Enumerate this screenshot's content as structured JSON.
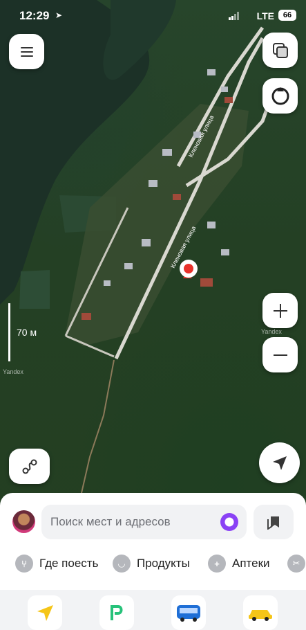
{
  "status_bar": {
    "time": "12:29",
    "network": "LTE",
    "battery": "66"
  },
  "map": {
    "scale_label": "70 м",
    "watermark": "Yandex",
    "street_label": "Кленовая улица"
  },
  "search": {
    "placeholder": "Поиск мест и адресов"
  },
  "categories": [
    {
      "label": "Где поесть",
      "icon": "fork-knife-icon"
    },
    {
      "label": "Продукты",
      "icon": "basket-icon"
    },
    {
      "label": "Аптеки",
      "icon": "pharmacy-cross-icon"
    }
  ],
  "colors": {
    "accent_purple": "#8a42f5",
    "pin_red": "#e8322b"
  }
}
